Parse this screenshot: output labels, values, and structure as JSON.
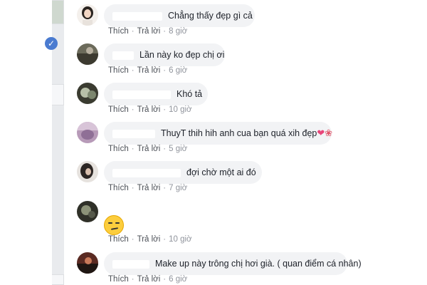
{
  "comments": [
    {
      "text": "Chẳng thấy đẹp gì cả",
      "like": "Thích",
      "reply": "Trả lời",
      "time": "8 giờ"
    },
    {
      "text": "Lần này ko đẹp chị ơi",
      "like": "Thích",
      "reply": "Trả lời",
      "time": "6 giờ"
    },
    {
      "text": "Khó tả",
      "like": "Thích",
      "reply": "Trả lời",
      "time": "10 giờ"
    },
    {
      "text": "ThuyT thih hih anh cua bạn quá xih đẹp",
      "like": "Thích",
      "reply": "Trả lời",
      "time": "5 giờ"
    },
    {
      "text": "đợi chờ một ai đó",
      "like": "Thích",
      "reply": "Trả lời",
      "time": "7 giờ"
    },
    {
      "text": "",
      "like": "Thích",
      "reply": "Trả lời",
      "time": "10 giờ"
    },
    {
      "text": "Make up này trông chị hơi già. ( quan điểm cá nhân)",
      "like": "Thích",
      "reply": "Trả lời",
      "time": "6 giờ"
    }
  ],
  "icons": {
    "verified": "verified-check-icon",
    "heart": "heart-icon",
    "flower": "flower-icon",
    "emoji": "smirk-emoji-icon"
  },
  "glyphs": {
    "verified": "✓",
    "heart": "❤",
    "flower": "❀"
  },
  "colors": {
    "bubble": "#f2f3f5",
    "action_text": "#4b4f56",
    "time_text": "#90949c",
    "verified": "#4a7bd0"
  }
}
